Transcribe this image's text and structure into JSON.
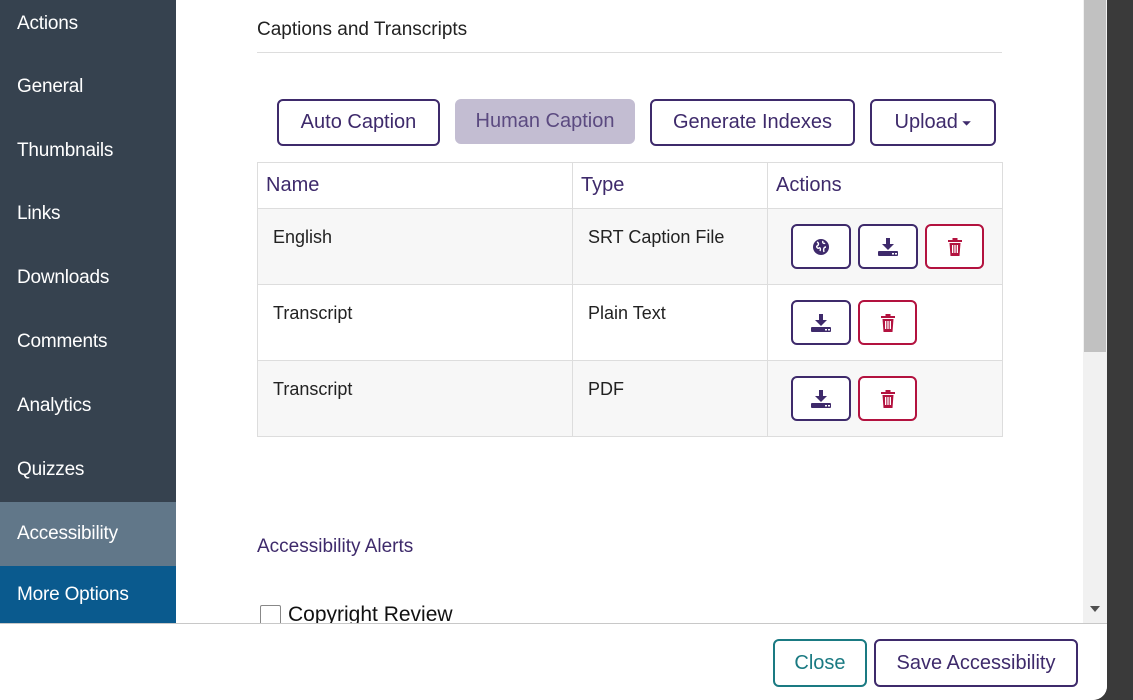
{
  "sidebar": {
    "items": [
      {
        "label": "Actions"
      },
      {
        "label": "General"
      },
      {
        "label": "Thumbnails"
      },
      {
        "label": "Links"
      },
      {
        "label": "Downloads"
      },
      {
        "label": "Comments"
      },
      {
        "label": "Analytics"
      },
      {
        "label": "Quizzes"
      },
      {
        "label": "Accessibility",
        "state": "active"
      },
      {
        "label": "More Options"
      }
    ]
  },
  "captions_section": {
    "title": "Captions and Transcripts",
    "buttons": {
      "auto_caption": "Auto Caption",
      "human_caption": "Human Caption",
      "generate_indexes": "Generate Indexes",
      "upload": "Upload",
      "upload_caret": "⏷"
    },
    "table": {
      "headers": [
        "Name",
        "Type",
        "Actions"
      ],
      "rows": [
        {
          "name": "English",
          "type": "SRT Caption File",
          "actions": [
            "globe-icon",
            "download-icon",
            "trash-icon"
          ]
        },
        {
          "name": "Transcript",
          "type": "Plain Text",
          "actions": [
            "download-icon",
            "trash-icon"
          ]
        },
        {
          "name": "Transcript",
          "type": "PDF",
          "actions": [
            "download-icon",
            "trash-icon"
          ]
        }
      ]
    }
  },
  "alerts_section": {
    "title": "Accessibility Alerts",
    "copyright_review": {
      "label": "Copyright Review",
      "checked": false
    }
  },
  "footer": {
    "close_label": "Close",
    "save_label": "Save Accessibility"
  },
  "colors": {
    "sidebar_bg": "#36424f",
    "sidebar_active": "#617789",
    "sidebar_more": "#0a5a8e",
    "primary": "#3e2a6b",
    "danger": "#b3123f",
    "teal": "#1a7a82",
    "disabled_bg": "#c3bdd2"
  }
}
